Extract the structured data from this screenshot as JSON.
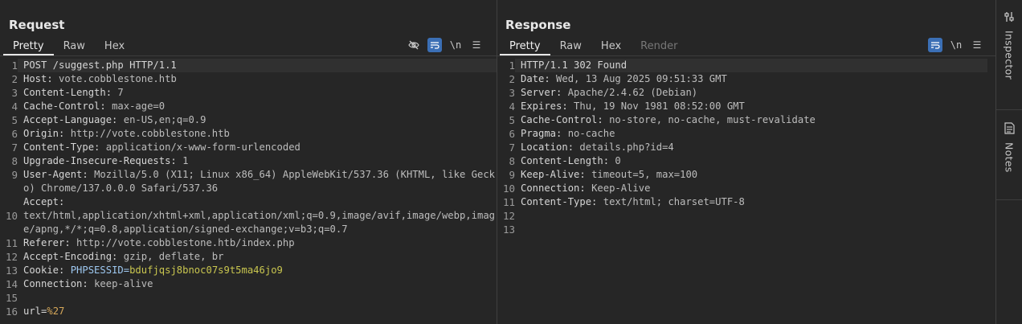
{
  "layout_buttons": [
    "split-horizontal",
    "split-vertical",
    "tabs-only"
  ],
  "request": {
    "title": "Request",
    "tabs": [
      "Pretty",
      "Raw",
      "Hex"
    ],
    "tools": {
      "newline_label": "\\n",
      "menu_label": "☰"
    },
    "lines": [
      {
        "n": "1",
        "k": "POST /suggest.php HTTP/1.1",
        "v": ""
      },
      {
        "n": "2",
        "k": "Host: ",
        "v": "vote.cobblestone.htb"
      },
      {
        "n": "3",
        "k": "Content-Length: ",
        "v": "7"
      },
      {
        "n": "4",
        "k": "Cache-Control: ",
        "v": "max-age=0"
      },
      {
        "n": "5",
        "k": "Accept-Language: ",
        "v": "en-US,en;q=0.9"
      },
      {
        "n": "6",
        "k": "Origin: ",
        "v": "http://vote.cobblestone.htb"
      },
      {
        "n": "7",
        "k": "Content-Type: ",
        "v": "application/x-www-form-urlencoded"
      },
      {
        "n": "8",
        "k": "Upgrade-Insecure-Requests: ",
        "v": "1"
      },
      {
        "n": "9",
        "k": "User-Agent: ",
        "v": "Mozilla/5.0 (X11; Linux x86_64) AppleWebKit/537.36 (KHTML, like Gecko) Chrome/137.0.0.0 Safari/537.36"
      },
      {
        "n": "10",
        "k": "Accept: ",
        "v": "text/html,application/xhtml+xml,application/xml;q=0.9,image/avif,image/webp,image/apng,*/*;q=0.8,application/signed-exchange;v=b3;q=0.7"
      },
      {
        "n": "11",
        "k": "Referer: ",
        "v": "http://vote.cobblestone.htb/index.php"
      },
      {
        "n": "12",
        "k": "Accept-Encoding: ",
        "v": "gzip, deflate, br"
      },
      {
        "n": "13",
        "k": "Cookie: ",
        "cookie_name": "PHPSESSID",
        "cookie_eq": "=",
        "cookie_val": "bdufjqsj8bnoc07s9t5ma46jo9"
      },
      {
        "n": "14",
        "k": "Connection: ",
        "v": "keep-alive"
      },
      {
        "n": "15",
        "k": "",
        "v": ""
      },
      {
        "n": "16",
        "k": "url=",
        "param_val": "%27"
      }
    ]
  },
  "response": {
    "title": "Response",
    "tabs": [
      "Pretty",
      "Raw",
      "Hex",
      "Render"
    ],
    "tools": {
      "newline_label": "\\n",
      "menu_label": "☰"
    },
    "lines": [
      {
        "n": "1",
        "k": "HTTP/1.1 302 Found",
        "v": ""
      },
      {
        "n": "2",
        "k": "Date: ",
        "v": "Wed, 13 Aug 2025 09:51:33 GMT"
      },
      {
        "n": "3",
        "k": "Server: ",
        "v": "Apache/2.4.62 (Debian)"
      },
      {
        "n": "4",
        "k": "Expires: ",
        "v": "Thu, 19 Nov 1981 08:52:00 GMT"
      },
      {
        "n": "5",
        "k": "Cache-Control: ",
        "v": "no-store, no-cache, must-revalidate"
      },
      {
        "n": "6",
        "k": "Pragma: ",
        "v": "no-cache"
      },
      {
        "n": "7",
        "k": "Location: ",
        "v": "details.php?id=4"
      },
      {
        "n": "8",
        "k": "Content-Length: ",
        "v": "0"
      },
      {
        "n": "9",
        "k": "Keep-Alive: ",
        "v": "timeout=5, max=100"
      },
      {
        "n": "10",
        "k": "Connection: ",
        "v": "Keep-Alive"
      },
      {
        "n": "11",
        "k": "Content-Type: ",
        "v": "text/html; charset=UTF-8"
      },
      {
        "n": "12",
        "k": "",
        "v": ""
      },
      {
        "n": "13",
        "k": "",
        "v": ""
      }
    ]
  },
  "sidebar": {
    "items": [
      {
        "label": "Inspector",
        "icon": "inspector-icon"
      },
      {
        "label": "Notes",
        "icon": "notes-icon"
      }
    ]
  },
  "colors": {
    "background": "#262626",
    "accent": "#3b6fb5",
    "cookie_name": "#9ec8f0",
    "cookie_value": "#c9c64f"
  }
}
